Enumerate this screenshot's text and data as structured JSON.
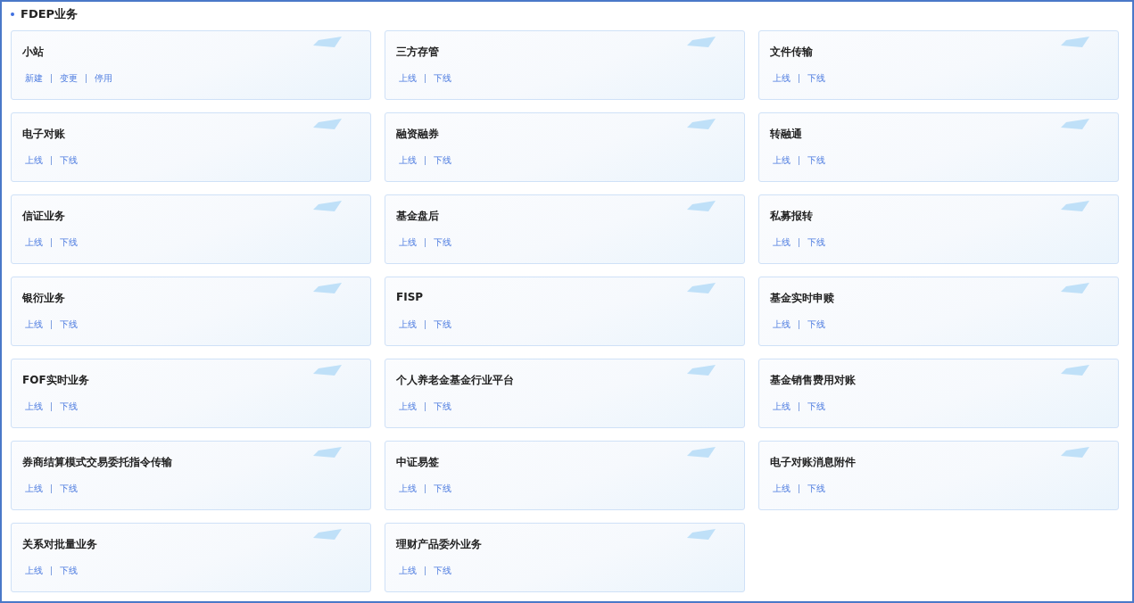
{
  "section": {
    "title": "FDEP业务"
  },
  "cards": [
    {
      "title": "小站",
      "actions": [
        "新建",
        "变更",
        "停用"
      ]
    },
    {
      "title": "三方存管",
      "actions": [
        "上线",
        "下线"
      ]
    },
    {
      "title": "文件传输",
      "actions": [
        "上线",
        "下线"
      ]
    },
    {
      "title": "电子对账",
      "actions": [
        "上线",
        "下线"
      ]
    },
    {
      "title": "融资融券",
      "actions": [
        "上线",
        "下线"
      ]
    },
    {
      "title": "转融通",
      "actions": [
        "上线",
        "下线"
      ]
    },
    {
      "title": "信证业务",
      "actions": [
        "上线",
        "下线"
      ]
    },
    {
      "title": "基金盘后",
      "actions": [
        "上线",
        "下线"
      ]
    },
    {
      "title": "私募报转",
      "actions": [
        "上线",
        "下线"
      ]
    },
    {
      "title": "银衍业务",
      "actions": [
        "上线",
        "下线"
      ]
    },
    {
      "title": "FISP",
      "actions": [
        "上线",
        "下线"
      ]
    },
    {
      "title": "基金实时申赎",
      "actions": [
        "上线",
        "下线"
      ]
    },
    {
      "title": "FOF实时业务",
      "actions": [
        "上线",
        "下线"
      ]
    },
    {
      "title": "个人养老金基金行业平台",
      "actions": [
        "上线",
        "下线"
      ]
    },
    {
      "title": "基金销售费用对账",
      "actions": [
        "上线",
        "下线"
      ]
    },
    {
      "title": "券商结算模式交易委托指令传输",
      "actions": [
        "上线",
        "下线"
      ]
    },
    {
      "title": "中证易签",
      "actions": [
        "上线",
        "下线"
      ]
    },
    {
      "title": "电子对账消息附件",
      "actions": [
        "上线",
        "下线"
      ]
    },
    {
      "title": "关系对批量业务",
      "actions": [
        "上线",
        "下线"
      ]
    },
    {
      "title": "理财产品委外业务",
      "actions": [
        "上线",
        "下线"
      ]
    }
  ]
}
